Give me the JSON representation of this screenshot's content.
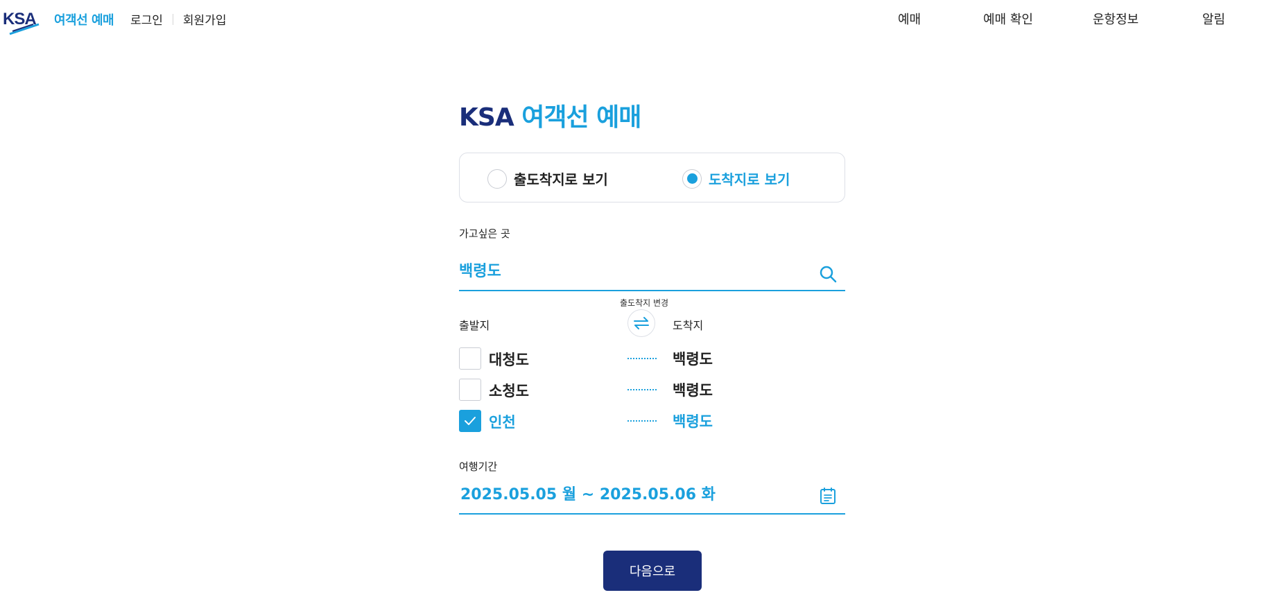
{
  "header": {
    "logo_text": "여객선 예매",
    "login": "로그인",
    "signup": "회원가입",
    "nav": [
      "예매",
      "예매 확인",
      "운항정보",
      "알림"
    ]
  },
  "main": {
    "title_brand": "KSA",
    "title_sub": "여객선 예매",
    "view_options": [
      {
        "label": "출도착지로 보기",
        "selected": false
      },
      {
        "label": "도착지로 보기",
        "selected": true
      }
    ],
    "destination": {
      "label": "가고싶은 곳",
      "value": "백령도"
    },
    "swap_caption": "출도착지 변경",
    "from_label": "출발지",
    "to_label": "도착지",
    "routes": [
      {
        "from": "대청도",
        "to": "백령도",
        "checked": false
      },
      {
        "from": "소청도",
        "to": "백령도",
        "checked": false
      },
      {
        "from": "인천",
        "to": "백령도",
        "checked": true
      }
    ],
    "period": {
      "label": "여행기간",
      "value": "2025.05.05 월 ~ 2025.05.06 화"
    },
    "next_button": "다음으로"
  },
  "colors": {
    "accent": "#1aa0dd",
    "brand_navy": "#1a2e7a",
    "border": "#dcdfe6"
  },
  "icons": [
    "ksa-logo",
    "search-icon",
    "swap-arrows-icon",
    "check-icon",
    "calendar-icon"
  ]
}
